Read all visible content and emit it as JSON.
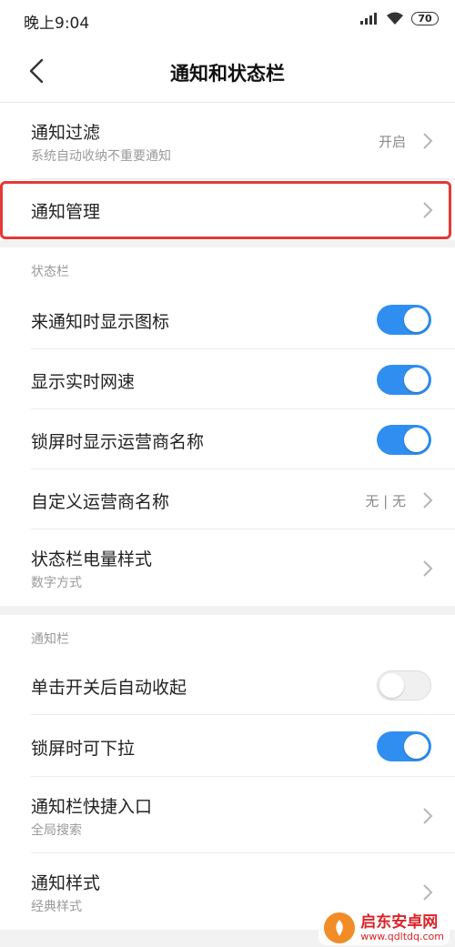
{
  "status_bar": {
    "time": "晚上9:04",
    "battery": "70"
  },
  "header": {
    "title": "通知和状态栏"
  },
  "notification_filter": {
    "label": "通知过滤",
    "sub": "系统自动收纳不重要通知",
    "value": "开启"
  },
  "notification_manage": {
    "label": "通知管理"
  },
  "status_section": {
    "header": "状态栏",
    "items": [
      {
        "label": "来通知时显示图标",
        "toggle": "on"
      },
      {
        "label": "显示实时网速",
        "toggle": "on"
      },
      {
        "label": "锁屏时显示运营商名称",
        "toggle": "on"
      },
      {
        "label": "自定义运营商名称",
        "value": "无 | 无"
      },
      {
        "label": "状态栏电量样式",
        "sub": "数字方式"
      }
    ]
  },
  "notif_section": {
    "header": "通知栏",
    "items": [
      {
        "label": "单击开关后自动收起",
        "toggle": "off"
      },
      {
        "label": "锁屏时可下拉",
        "toggle": "on"
      },
      {
        "label": "通知栏快捷入口",
        "sub": "全局搜索"
      },
      {
        "label": "通知样式",
        "sub": "经典样式"
      }
    ]
  },
  "watermark": {
    "title": "启东安卓网",
    "url": "www.qdltdq.com"
  },
  "colors": {
    "accent": "#2f8ef0",
    "highlight": "#e53935"
  }
}
